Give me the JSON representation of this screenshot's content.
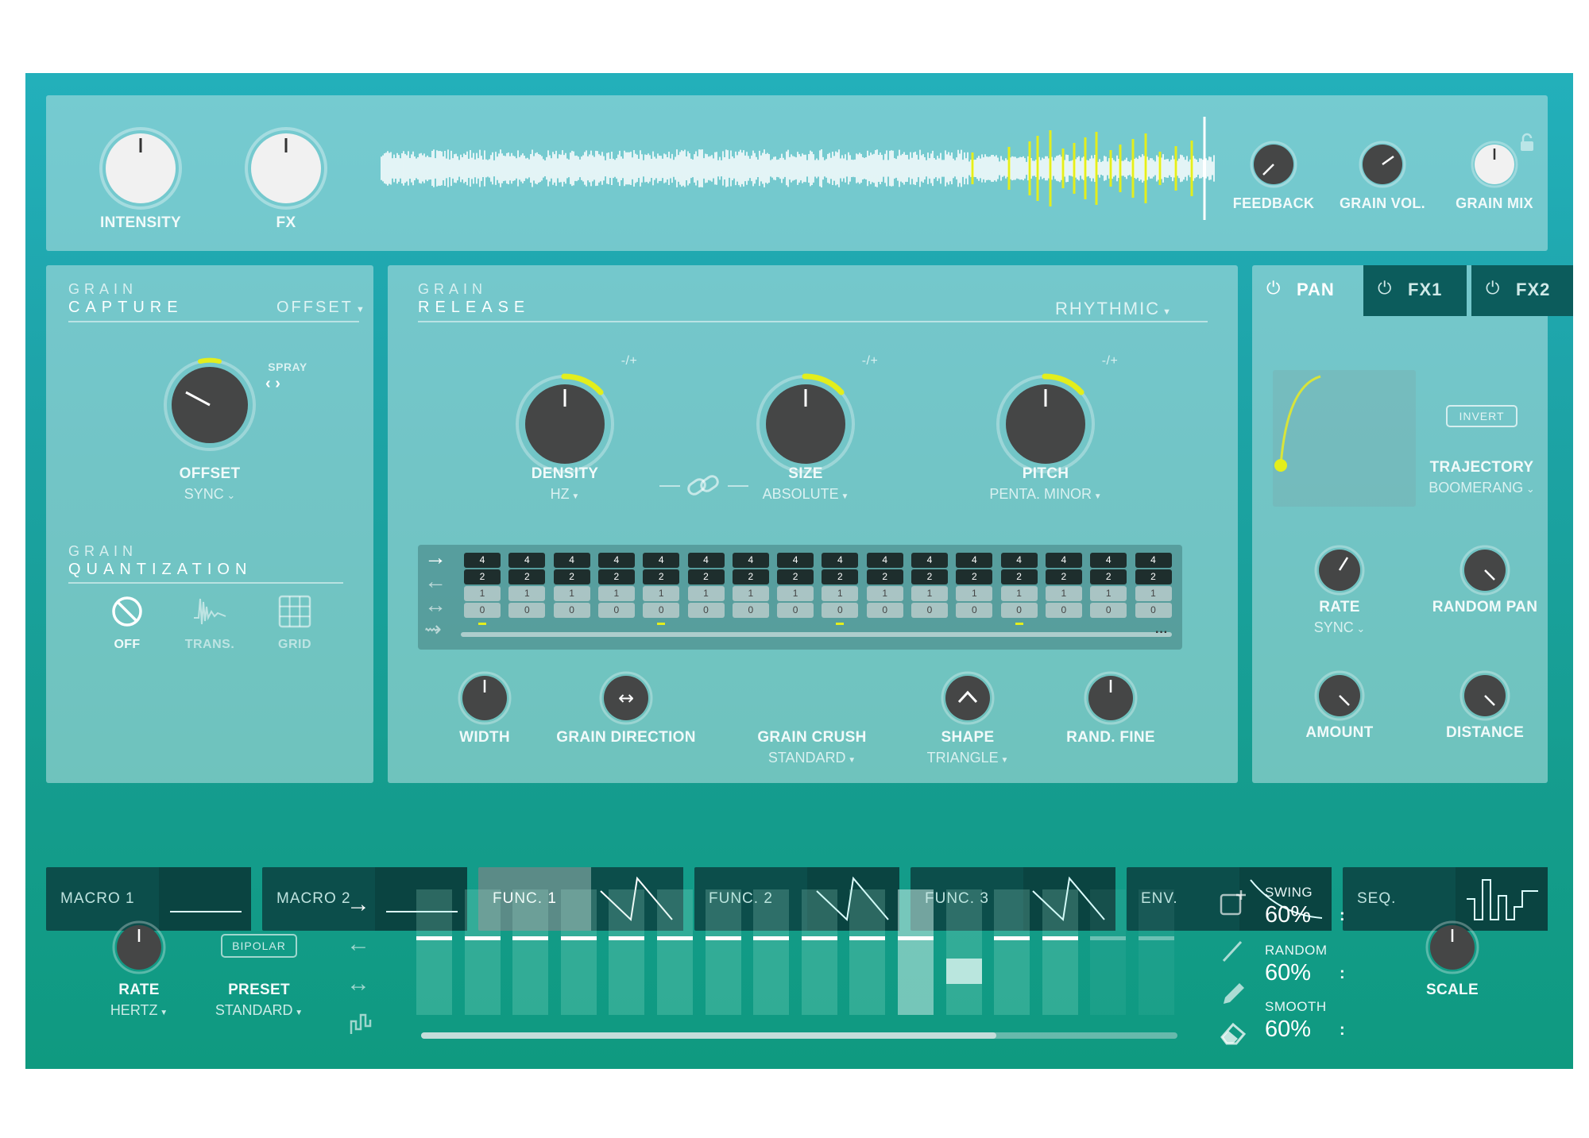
{
  "top": {
    "intensity_label": "INTENSITY",
    "fx_label": "FX",
    "feedback_label": "FEEDBACK",
    "grain_vol_label": "GRAIN VOL.",
    "grain_mix_label": "GRAIN MIX"
  },
  "capture": {
    "title_line1": "GRAIN",
    "title_line2": "CAPTURE",
    "mode": "OFFSET",
    "spray_label": "SPRAY",
    "offset_label": "OFFSET",
    "offset_sub": "SYNC"
  },
  "quantization": {
    "title_line1": "GRAIN",
    "title_line2": "QUANTIZATION",
    "options": [
      "OFF",
      "TRANS.",
      "GRID"
    ]
  },
  "release": {
    "title_line1": "GRAIN",
    "title_line2": "RELEASE",
    "mode": "RHYTHMIC",
    "pm": "-/+",
    "density_label": "DENSITY",
    "density_sub": "HZ",
    "size_label": "SIZE",
    "size_sub": "ABSOLUTE",
    "pitch_label": "PITCH",
    "pitch_sub": "PENTA. MINOR",
    "grid_values": [
      "4",
      "2",
      "1",
      "0"
    ],
    "width_label": "WIDTH",
    "direction_label": "GRAIN DIRECTION",
    "crush_label": "GRAIN CRUSH",
    "crush_sub": "STANDARD",
    "shape_label": "SHAPE",
    "shape_sub": "TRIANGLE",
    "rand_label": "RAND. FINE"
  },
  "pan": {
    "tabs": [
      "PAN",
      "FX1",
      "FX2"
    ],
    "invert": "INVERT",
    "trajectory_label": "TRAJECTORY",
    "trajectory_sub": "BOOMERANG",
    "rate_label": "RATE",
    "rate_sub": "SYNC",
    "random_pan_label": "RANDOM PAN",
    "amount_label": "AMOUNT",
    "distance_label": "DISTANCE"
  },
  "mod_tabs": [
    "MACRO 1",
    "MACRO 2",
    "FUNC. 1",
    "FUNC. 2",
    "FUNC. 3",
    "ENV.",
    "SEQ."
  ],
  "sequencer": {
    "rate_label": "RATE",
    "rate_sub": "HERTZ",
    "bipolar": "BIPOLAR",
    "preset_label": "PRESET",
    "preset_sub": "STANDARD",
    "swing_label": "SWING",
    "swing_value": "60%",
    "random_label": "RANDOM",
    "random_value": "60%",
    "smooth_label": "SMOOTH",
    "smooth_value": "60%",
    "scale_label": "SCALE"
  },
  "colors": {
    "accent": "#e3ee1c",
    "knob_dark": "#454646",
    "knob_light": "#f1f1f1",
    "tab_dark": "#0c4e4b"
  }
}
